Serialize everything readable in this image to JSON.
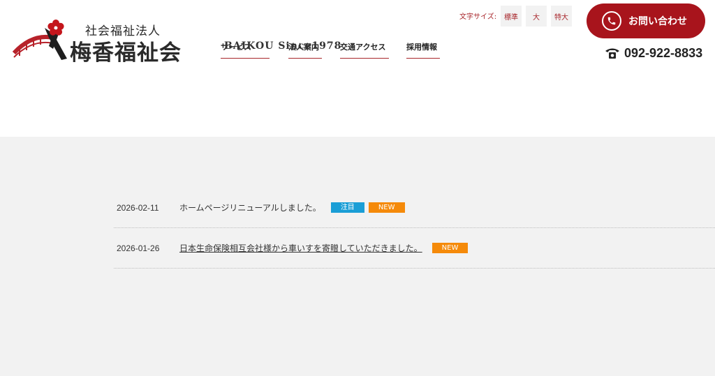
{
  "logo": {
    "subtitle": "社会福祉法人",
    "name": "梅香福祉会"
  },
  "nav": {
    "overlay_text": "BAIKOU Since1978",
    "items": [
      {
        "label": "サービス"
      },
      {
        "label": "法人案内"
      },
      {
        "label": "交通アクセス"
      },
      {
        "label": "採用情報"
      }
    ]
  },
  "font_size": {
    "label": "文字サイズ:",
    "options": [
      "標準",
      "大",
      "特大"
    ]
  },
  "contact": {
    "label": "お問い合わせ",
    "phone": "092-922-8833"
  },
  "news": [
    {
      "date": "2026-02-11",
      "title": "ホームページリニューアルしました。",
      "linked": false,
      "badges": [
        "注目",
        "NEW"
      ]
    },
    {
      "date": "2026-01-26",
      "title": "日本生命保険相互会社様から車いすを寄贈していただきました。",
      "linked": true,
      "badges": [
        "NEW"
      ]
    }
  ],
  "colors": {
    "brand_red": "#a8141c",
    "accent_blue": "#1a9ed6",
    "accent_orange": "#f58a0a",
    "content_bg": "#f2f2f2"
  }
}
